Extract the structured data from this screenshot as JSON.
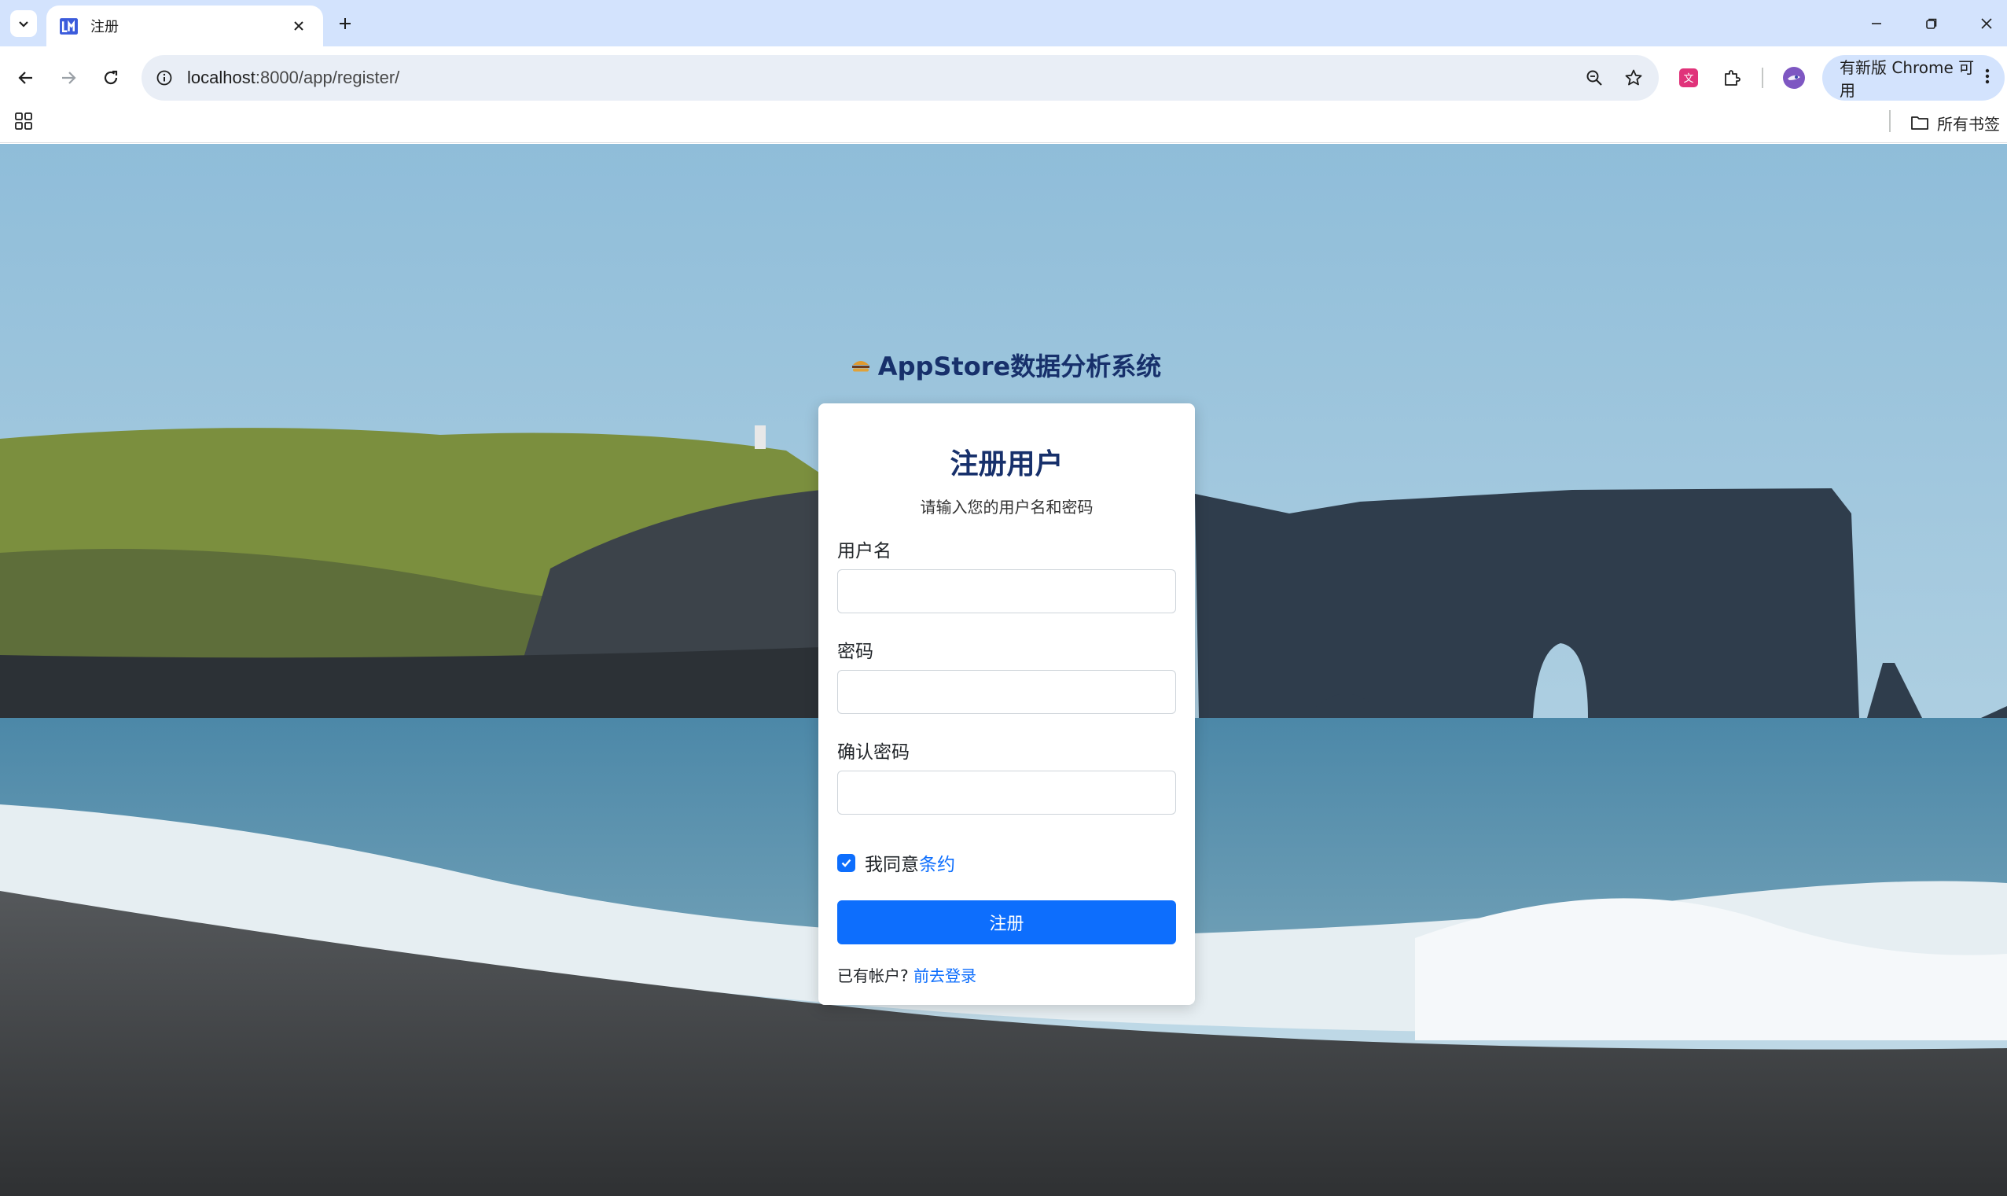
{
  "browser": {
    "tab": {
      "title": "注册"
    },
    "url": {
      "host": "localhost",
      "rest": ":8000/app/register/"
    },
    "update_chip": "有新版 Chrome 可用",
    "bookmarks": {
      "all_label": "所有书签"
    }
  },
  "page": {
    "brand": "AppStore数据分析系统",
    "form": {
      "title": "注册用户",
      "subtitle": "请输入您的用户名和密码",
      "username_label": "用户名",
      "username_value": "",
      "password_label": "密码",
      "password_value": "",
      "confirm_label": "确认密码",
      "confirm_value": "",
      "agree_prefix": "我同意",
      "agree_link": "条约",
      "agree_checked": true,
      "submit_label": "注册",
      "login_prefix": "已有帐户?",
      "login_link": "前去登录"
    }
  },
  "colors": {
    "primary": "#0d6efd",
    "brand_text": "#17306b",
    "tabstrip": "#d3e3fd"
  }
}
